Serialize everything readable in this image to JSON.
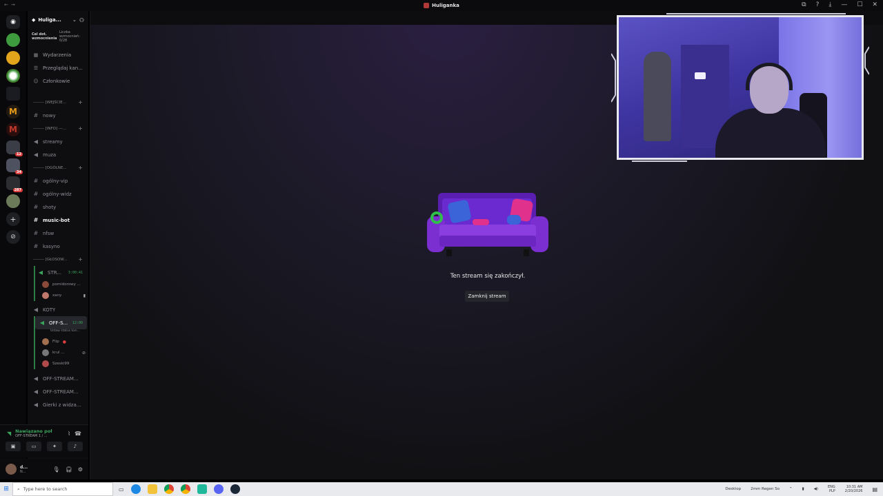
{
  "window": {
    "title": "Huliganka",
    "controls": [
      "⧉",
      "?",
      "⤓",
      "—",
      "☐",
      "✕"
    ]
  },
  "server": {
    "name": "Huliga...",
    "boost_goal": "Cel dot. wzmocnienia",
    "boost_label": "Liczba wzmocnień:",
    "boost_count": "0/28"
  },
  "nav": [
    {
      "icon": "calendar-icon",
      "glyph": "▦",
      "label": "Wydarzenia"
    },
    {
      "icon": "browse-channels-icon",
      "glyph": "☰",
      "label": "Przeglądaj kan..."
    },
    {
      "icon": "members-icon",
      "glyph": "☺",
      "label": "Członkowie"
    }
  ],
  "categories": {
    "entry": "-------- [WEJŚCIE...",
    "info": "-------- [INFO] ---...",
    "general": "-------- [OGÓLNE...",
    "voice": "-------- [GŁOSOW..."
  },
  "channels": {
    "nowy": "nowy",
    "streamy": "streamy",
    "muza": "muza",
    "ogolny_vip": "ogólny-vip",
    "ogolny_widz": "ogólny-widz",
    "shoty": "shoty",
    "music_bot": "music-bot",
    "nfsw": "nfsw",
    "kasyno": "kasyno"
  },
  "voice": {
    "str": {
      "name": "STR...",
      "timer": "3:00:41",
      "users": [
        "pomidorowy ...",
        "xany"
      ]
    },
    "koty": "KOTY",
    "off_s": {
      "name": "OFF-S...",
      "timer": "12:00",
      "status": "Ustaw status kan...",
      "users": [
        "Flip",
        "krul ...",
        "Szeski99"
      ]
    },
    "off_stream_1": "OFF-STREAM...",
    "off_stream_2": "OFF-STREAM...",
    "gierki": "Gierki z widza...",
    "gierki_2": "Gierki z widza..."
  },
  "voice_panel": {
    "status": "Nawiązano poł",
    "channel": "OFF-STREAM 1 / ..."
  },
  "user_panel": {
    "name": "d...",
    "sub": "N..."
  },
  "stream": {
    "ended": "Ten stream się zakończył.",
    "close_label": "Zamknij stream"
  },
  "taskbar": {
    "search_placeholder": "Type here to search",
    "desktop": "Desktop",
    "weather": "2mm Regen So",
    "lang": "ENG",
    "lang2": "PLP",
    "time": "10:31 AM",
    "date": "2/20/2026"
  },
  "colors": {
    "accent_green": "#3ba55d",
    "brand": "#5865f2",
    "couch": "#7b2fd0"
  }
}
